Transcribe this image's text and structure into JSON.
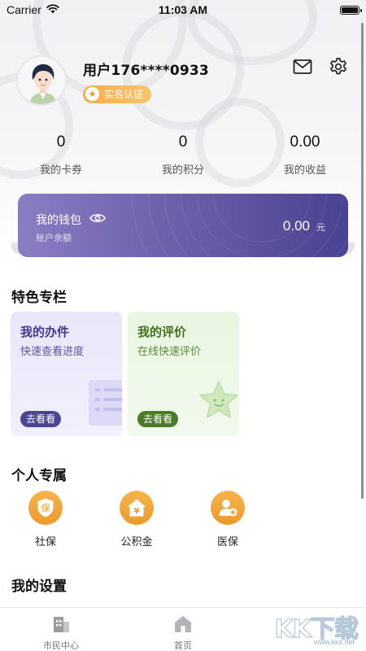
{
  "status_bar": {
    "carrier": "Carrier",
    "time": "11:03 AM"
  },
  "profile": {
    "username": "用户176****0933",
    "verify_label": "实名认证"
  },
  "stats": [
    {
      "value": "0",
      "label": "我的卡券"
    },
    {
      "value": "0",
      "label": "我的积分"
    },
    {
      "value": "0.00",
      "label": "我的收益"
    }
  ],
  "wallet": {
    "title": "我的钱包",
    "subtitle": "账户余额",
    "amount": "0.00",
    "unit": "元"
  },
  "featured": {
    "title": "特色专栏",
    "cards": [
      {
        "title": "我的办件",
        "subtitle": "快速查看进度",
        "button": "去看看"
      },
      {
        "title": "我的评价",
        "subtitle": "在线快速评价",
        "button": "去看看"
      }
    ]
  },
  "personal": {
    "title": "个人专属",
    "items": [
      {
        "label": "社保",
        "icon": "保"
      },
      {
        "label": "公积金",
        "icon": "¥"
      },
      {
        "label": "医保",
        "icon": "medical-person-icon"
      }
    ]
  },
  "settings": {
    "title": "我的设置"
  },
  "tab_bar": {
    "tabs": [
      {
        "label": "市民中心",
        "icon": "building-icon"
      },
      {
        "label": "首页",
        "icon": "home-icon"
      }
    ]
  },
  "watermark": {
    "logo": "KK下载",
    "url": "www.kkx.net"
  },
  "colors": {
    "wallet_start": "#8b7dc3",
    "wallet_end": "#4a4391",
    "accent_orange": "#f0a43a",
    "office_card": "#e8e7fa",
    "review_card": "#e9f6e1"
  }
}
